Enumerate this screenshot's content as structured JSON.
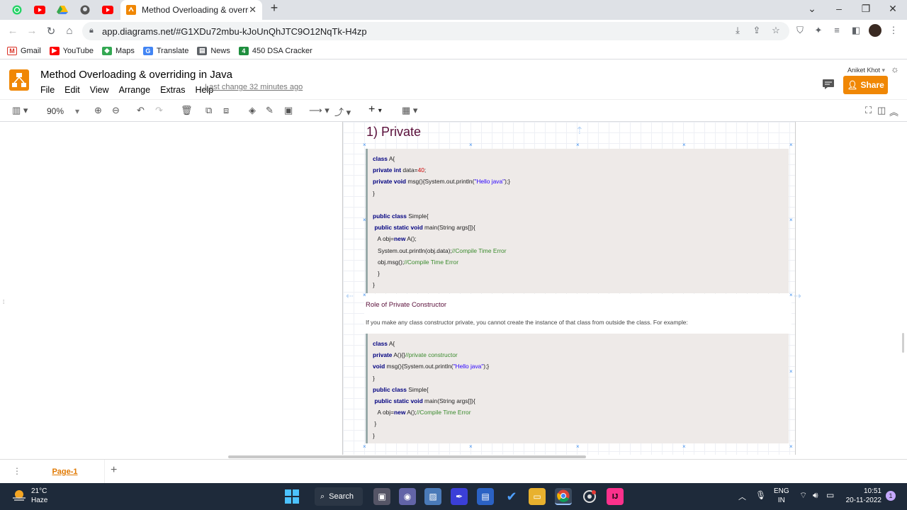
{
  "browser": {
    "active_tab_title": "Method Overloading & overridin",
    "url": "app.diagrams.net/#G1XDu72mbu-kJoUnQhJTC9O12NqTk-H4zp",
    "bookmarks": [
      {
        "label": "Gmail",
        "color": "#d93025"
      },
      {
        "label": "YouTube",
        "color": "#ff0000"
      },
      {
        "label": "Maps",
        "color": "#34a853"
      },
      {
        "label": "Translate",
        "color": "#4285f4"
      },
      {
        "label": "News",
        "color": "#5f6368"
      },
      {
        "label": "450 DSA Cracker",
        "color": "#1e8e3e",
        "glyph": "4"
      }
    ]
  },
  "app": {
    "title": "Method Overloading & overriding in Java",
    "menu": [
      "File",
      "Edit",
      "View",
      "Arrange",
      "Extras",
      "Help"
    ],
    "last_change": "Last change 32 minutes ago",
    "user": "Aniket Khot",
    "share_label": "Share",
    "zoom": "90%",
    "brand_color": "#f08705"
  },
  "diagram": {
    "heading": "1) Private",
    "code1": [
      [
        {
          "t": "class",
          "c": "kw"
        },
        {
          "t": " A{"
        }
      ],
      [
        {
          "t": "private int",
          "c": "kw"
        },
        {
          "t": " data="
        },
        {
          "t": "40",
          "c": "num"
        },
        {
          "t": ";"
        }
      ],
      [
        {
          "t": "private void",
          "c": "kw"
        },
        {
          "t": " msg(){System.out.println("
        },
        {
          "t": "\"Hello java\"",
          "c": "st"
        },
        {
          "t": ");}"
        }
      ],
      [
        {
          "t": "}"
        }
      ],
      [
        {
          "t": ""
        }
      ],
      [
        {
          "t": "public class",
          "c": "kw"
        },
        {
          "t": " Simple{"
        }
      ],
      [
        {
          "t": " public static void",
          "c": "kw"
        },
        {
          "t": " main(String args[]){"
        }
      ],
      [
        {
          "t": "   A obj="
        },
        {
          "t": "new",
          "c": "kw"
        },
        {
          "t": " A();"
        }
      ],
      [
        {
          "t": "   System.out.println(obj.data);"
        },
        {
          "t": "//Compile Time Error",
          "c": "cm"
        }
      ],
      [
        {
          "t": "   obj.msg();"
        },
        {
          "t": "//Compile Time Error",
          "c": "cm"
        }
      ],
      [
        {
          "t": "   }"
        }
      ],
      [
        {
          "t": "}"
        }
      ]
    ],
    "role_title": "Role of Private Constructor",
    "role_desc": "If you make any class constructor private, you cannot create the instance of that class from outside the class. For example:",
    "code2": [
      [
        {
          "t": "class",
          "c": "kw"
        },
        {
          "t": " A{"
        }
      ],
      [
        {
          "t": "private",
          "c": "kw"
        },
        {
          "t": " A(){}"
        },
        {
          "t": "//private constructor",
          "c": "cm"
        }
      ],
      [
        {
          "t": "void",
          "c": "kw"
        },
        {
          "t": " msg(){System.out.println("
        },
        {
          "t": "\"Hello java\"",
          "c": "st"
        },
        {
          "t": ");}"
        }
      ],
      [
        {
          "t": "}"
        }
      ],
      [
        {
          "t": "public class",
          "c": "kw"
        },
        {
          "t": " Simple{"
        }
      ],
      [
        {
          "t": " public static void",
          "c": "kw"
        },
        {
          "t": " main(String args[]){"
        }
      ],
      [
        {
          "t": "   A obj="
        },
        {
          "t": "new",
          "c": "kw"
        },
        {
          "t": " A();"
        },
        {
          "t": "//Compile Time Error",
          "c": "cm"
        }
      ],
      [
        {
          "t": " }"
        }
      ],
      [
        {
          "t": "}"
        }
      ]
    ]
  },
  "pages": {
    "current": "Page-1"
  },
  "taskbar": {
    "temperature": "21°C",
    "weather": "Haze",
    "search_label": "Search",
    "lang_top": "ENG",
    "lang_bottom": "IN",
    "time": "10:51",
    "date": "20-11-2022"
  }
}
